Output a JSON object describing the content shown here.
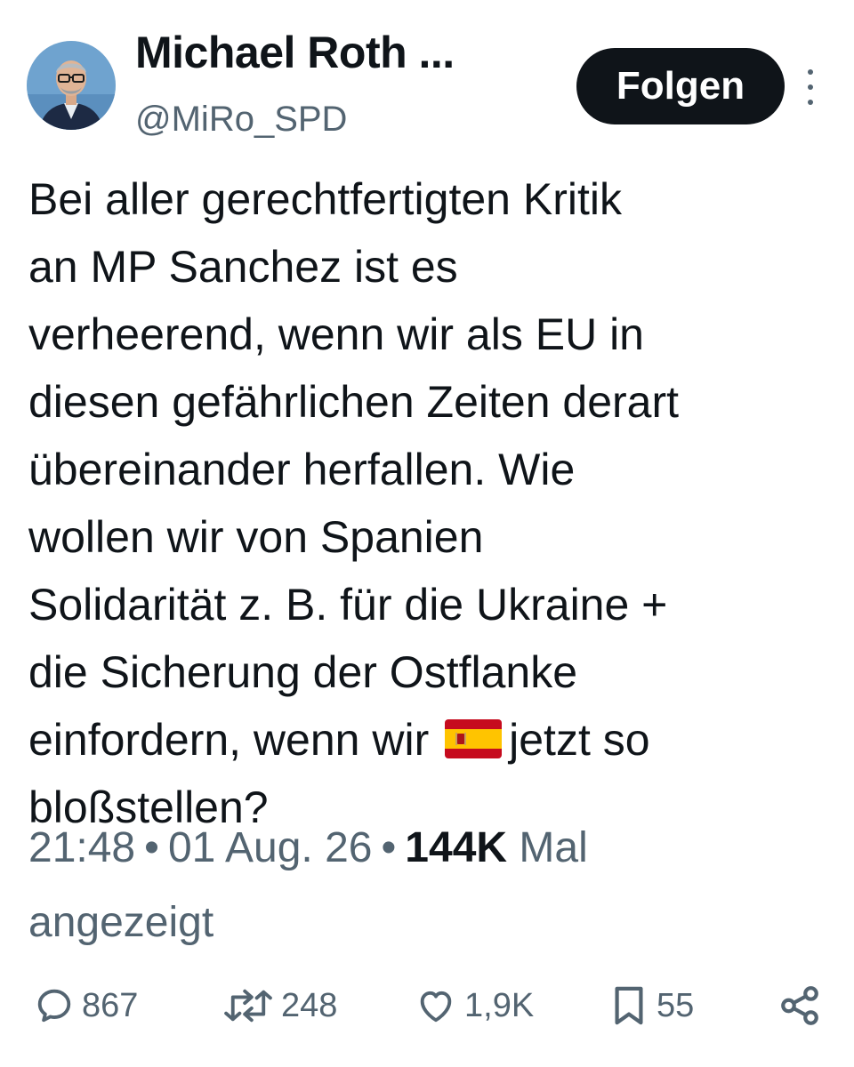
{
  "author": {
    "display_name": "Michael Roth ...",
    "handle": "@MiRo_SPD"
  },
  "follow_button": {
    "label": "Folgen"
  },
  "tweet": {
    "lines": [
      "Bei aller gerechtfertigten Kritik",
      "an MP Sanchez ist es",
      "verheerend, wenn wir als EU in",
      "diesen gefährlichen Zeiten derart",
      "übereinander herfallen. Wie",
      "wollen wir von Spanien",
      "Solidarität z. B. für die Ukraine +",
      "die Sicherung der Ostflanke",
      "einfordern, wenn wir",
      "jetzt so",
      "bloßstellen?"
    ],
    "emoji": "spain-flag-emoji"
  },
  "meta": {
    "time": "21:48",
    "separator": "•",
    "date": "01 Aug. 26",
    "views_count": "144K",
    "views_label": "Mal",
    "views_label_2": "angezeigt"
  },
  "actions": {
    "replies": "867",
    "reposts": "248",
    "likes": "1,9K",
    "bookmarks": "55"
  },
  "colors": {
    "text": "#0f1419",
    "secondary": "#536471",
    "button_bg": "#0f1419",
    "button_text": "#ffffff",
    "background": "#ffffff"
  }
}
